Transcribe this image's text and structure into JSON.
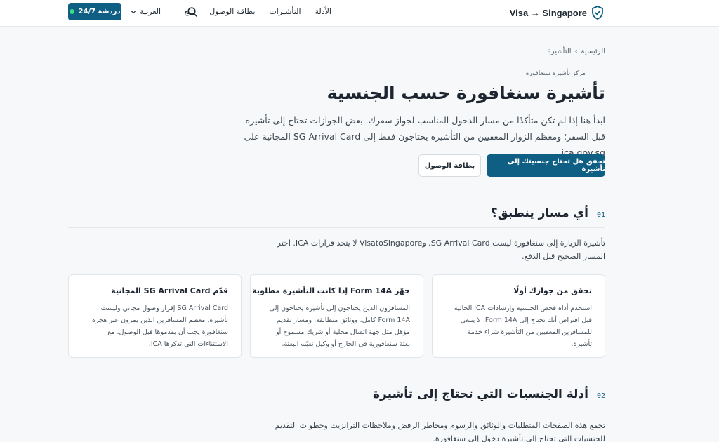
{
  "header": {
    "brand": "Visa → Singapore",
    "nav": [
      "الأدلة",
      "التأشيرات",
      "بطاقة الوصول",
      "تتبع"
    ],
    "language": "العربية",
    "chat_label": "دردشة 24/7"
  },
  "breadcrumb": [
    "الرئيسية",
    "›",
    "التأشيرة"
  ],
  "hero": {
    "eyebrow": "مركز تأشيرة سنغافورة",
    "title": "تأشيرة سنغافورة حسب الجنسية",
    "lead": "ابدأ هنا إذا لم تكن متأكدًا من مسار الدخول المناسب لجواز سفرك. بعض الجوازات تحتاج إلى تأشيرة قبل السفر؛ ومعظم الزوار المعفيين من التأشيرة يحتاجون فقط إلى SG Arrival Card المجانية على ica.gov.sg.",
    "primary_button": "تحقق هل تحتاج جنسيتك إلى تأشيرة",
    "secondary_button": "بطاقة الوصول"
  },
  "section1": {
    "number": "01",
    "title": "أي مسار ينطبق؟",
    "text": "تأشيرة الزيارة إلى سنغافورة ليست SG Arrival Card، وVisatoSingapore لا يتخذ قرارات ICA. اختر المسار الصحيح قبل الدفع."
  },
  "cards": [
    {
      "title": "تحقق من جوازك أولًا",
      "body": "استخدم أداة فحص الجنسية وإرشادات ICA الحالية قبل افتراض أنك تحتاج إلى Form 14A. لا ينبغي للمسافرين المعفيين من التأشيرة شراء خدمة تأشيرة."
    },
    {
      "title": "جهّز Form 14A إذا كانت التأشيرة مطلوبة",
      "body": "المسافرون الذين يحتاجون إلى تأشيرة يحتاجون إلى Form 14A كامل، ووثائق متطابقة، ومسار تقديم مؤهل مثل جهة اتصال محلية أو شريك مسموح أو بعثة سنغافورية في الخارج أو وكيل تعيّنه البعثة."
    },
    {
      "title": "قدّم SG Arrival Card المجانية",
      "body": "SG Arrival Card إقرار وصول مجاني وليست تأشيرة. معظم المسافرين الذين يمرون عبر هجرة سنغافورة يجب أن يقدموها قبل الوصول، مع الاستثناءات التي تذكرها ICA."
    }
  ],
  "section2": {
    "number": "02",
    "title": "أدلة الجنسيات التي تحتاج إلى تأشيرة",
    "text": "تجمع هذه الصفحات المتطلبات والوثائق والرسوم ومخاطر الرفض وملاحظات الترانزيت وخطوات التقديم للجنسيات التي تحتاج إلى تأشيرة دخول إلى سنغافورة."
  },
  "colors": {
    "accent": "#0f5e84",
    "online": "#3ddc84"
  }
}
